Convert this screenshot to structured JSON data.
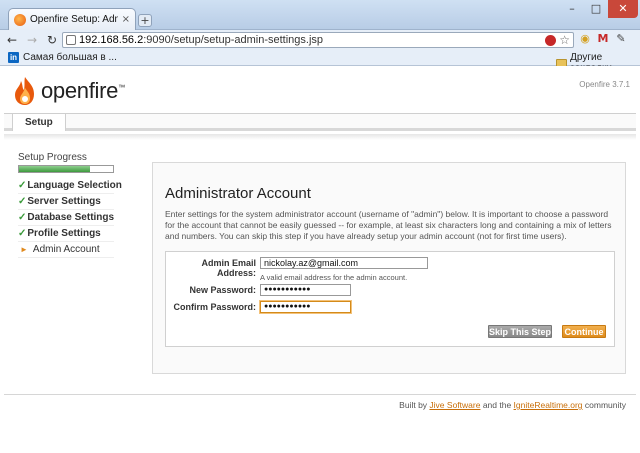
{
  "browser": {
    "tab_title": "Openfire Setup: Administrati",
    "tab_close": "×",
    "new_tab": "+",
    "window_controls": {
      "minimize": "–",
      "maximize": "□",
      "close": "✕"
    },
    "url_host": "192.168.56.2",
    "url_path": ":9090/setup/setup-admin-settings.jsp",
    "bookmarks": {
      "left_label": "Самая большая в ...",
      "right_label": "Другие закладки"
    }
  },
  "header": {
    "logo_text": "openfire",
    "logo_tm": "™",
    "version": "Openfire 3.7.1",
    "tab_label": "Setup"
  },
  "sidebar": {
    "progress_label": "Setup Progress",
    "progress_fraction": 0.75,
    "steps": [
      {
        "label": "Language Selection",
        "status": "done"
      },
      {
        "label": "Server Settings",
        "status": "done"
      },
      {
        "label": "Database Settings",
        "status": "done"
      },
      {
        "label": "Profile Settings",
        "status": "done"
      },
      {
        "label": "Admin Account",
        "status": "current"
      }
    ]
  },
  "main": {
    "title": "Administrator Account",
    "intro": "Enter settings for the system administrator account (username of \"admin\") below. It is important to choose a password for the account that cannot be easily guessed -- for example, at least six characters long and containing a mix of letters and numbers. You can skip this step if you have already setup your admin account (not for first time users).",
    "fields": {
      "email_label": "Admin Email Address:",
      "email_value": "nickolay.az@gmail.com",
      "email_hint": "A valid email address for the admin account.",
      "new_password_label": "New Password:",
      "new_password_value": "●●●●●●●●●●●",
      "confirm_password_label": "Confirm Password:",
      "confirm_password_value": "●●●●●●●●●●●"
    },
    "buttons": {
      "skip": "Skip This Step",
      "continue": "Continue"
    }
  },
  "footer": {
    "prefix": "Built by ",
    "link1": "Jive Software",
    "middle": " and the ",
    "link2": "IgniteRealtime.org",
    "suffix": " community"
  },
  "colors": {
    "accent_orange": "#de8b1b",
    "progress_green": "#3e9a3e",
    "check_green": "#3a9a3a"
  }
}
